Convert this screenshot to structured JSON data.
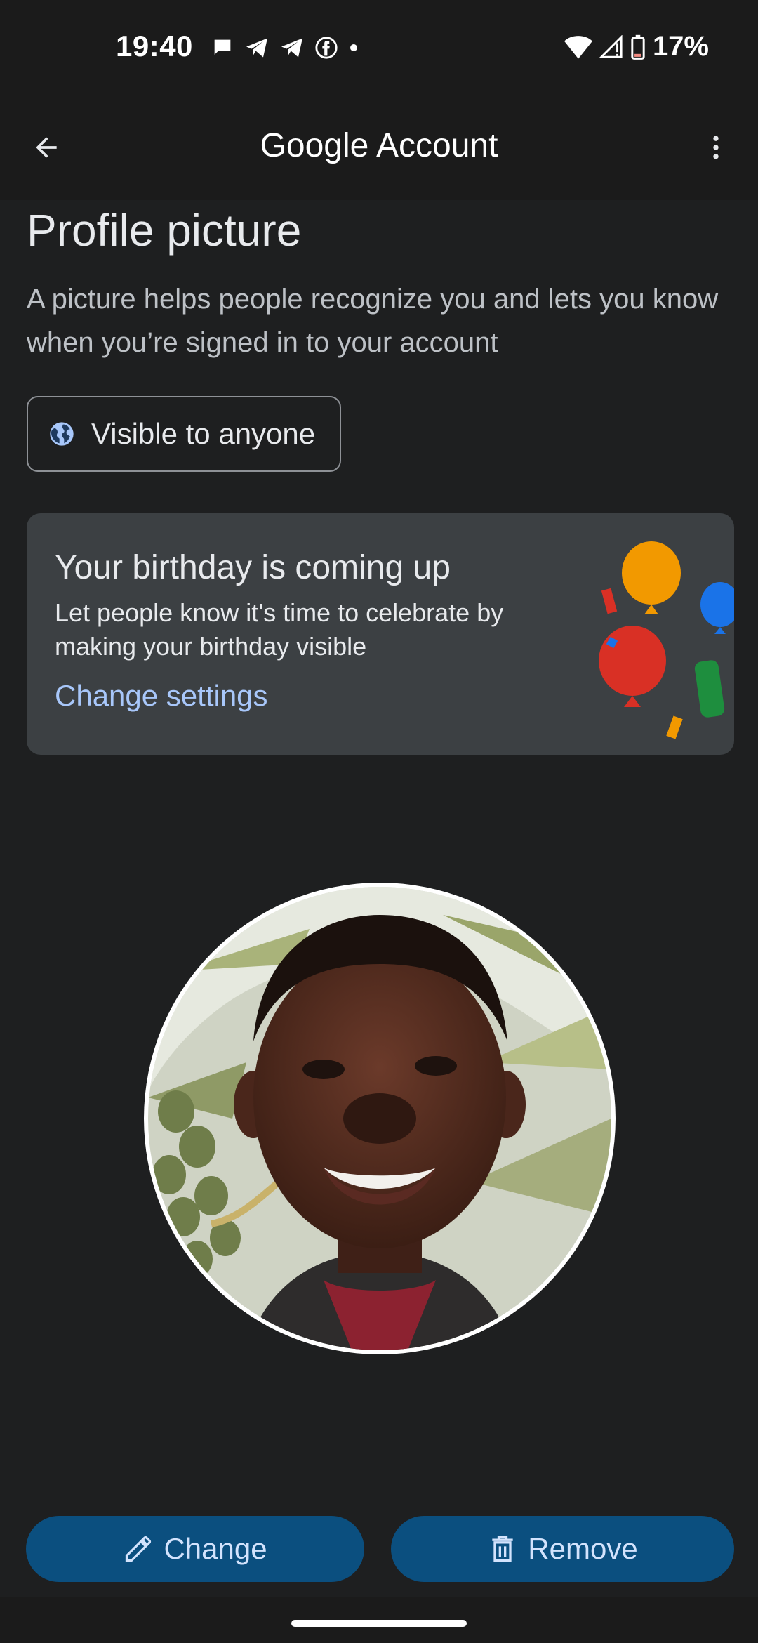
{
  "status_bar": {
    "time": "19:40",
    "battery": "17%",
    "left_icons": [
      "chat-bubble-icon",
      "telegram-icon",
      "telegram-icon",
      "facebook-icon",
      "dot-icon"
    ],
    "right_icons": [
      "wifi-icon",
      "signal-icon",
      "battery-icon"
    ]
  },
  "app_bar": {
    "title": "Google Account",
    "back_icon": "arrow-back-icon",
    "menu_icon": "more-vert-icon"
  },
  "profile": {
    "title": "Profile picture",
    "description": "A picture helps people recognize you and lets you know when you’re signed in to your account",
    "visibility_label": "Visible to anyone"
  },
  "birthday_card": {
    "title": "Your birthday is coming up",
    "text": "Let people know it's time to celebrate by making your birthday visible",
    "link": "Change settings"
  },
  "actions": {
    "change_label": "Change",
    "remove_label": "Remove"
  },
  "colors": {
    "background": "#1e1f20",
    "card": "#3c4043",
    "link": "#a8c7fa",
    "button": "#0b4f7f",
    "button_text": "#d3e3fd"
  }
}
